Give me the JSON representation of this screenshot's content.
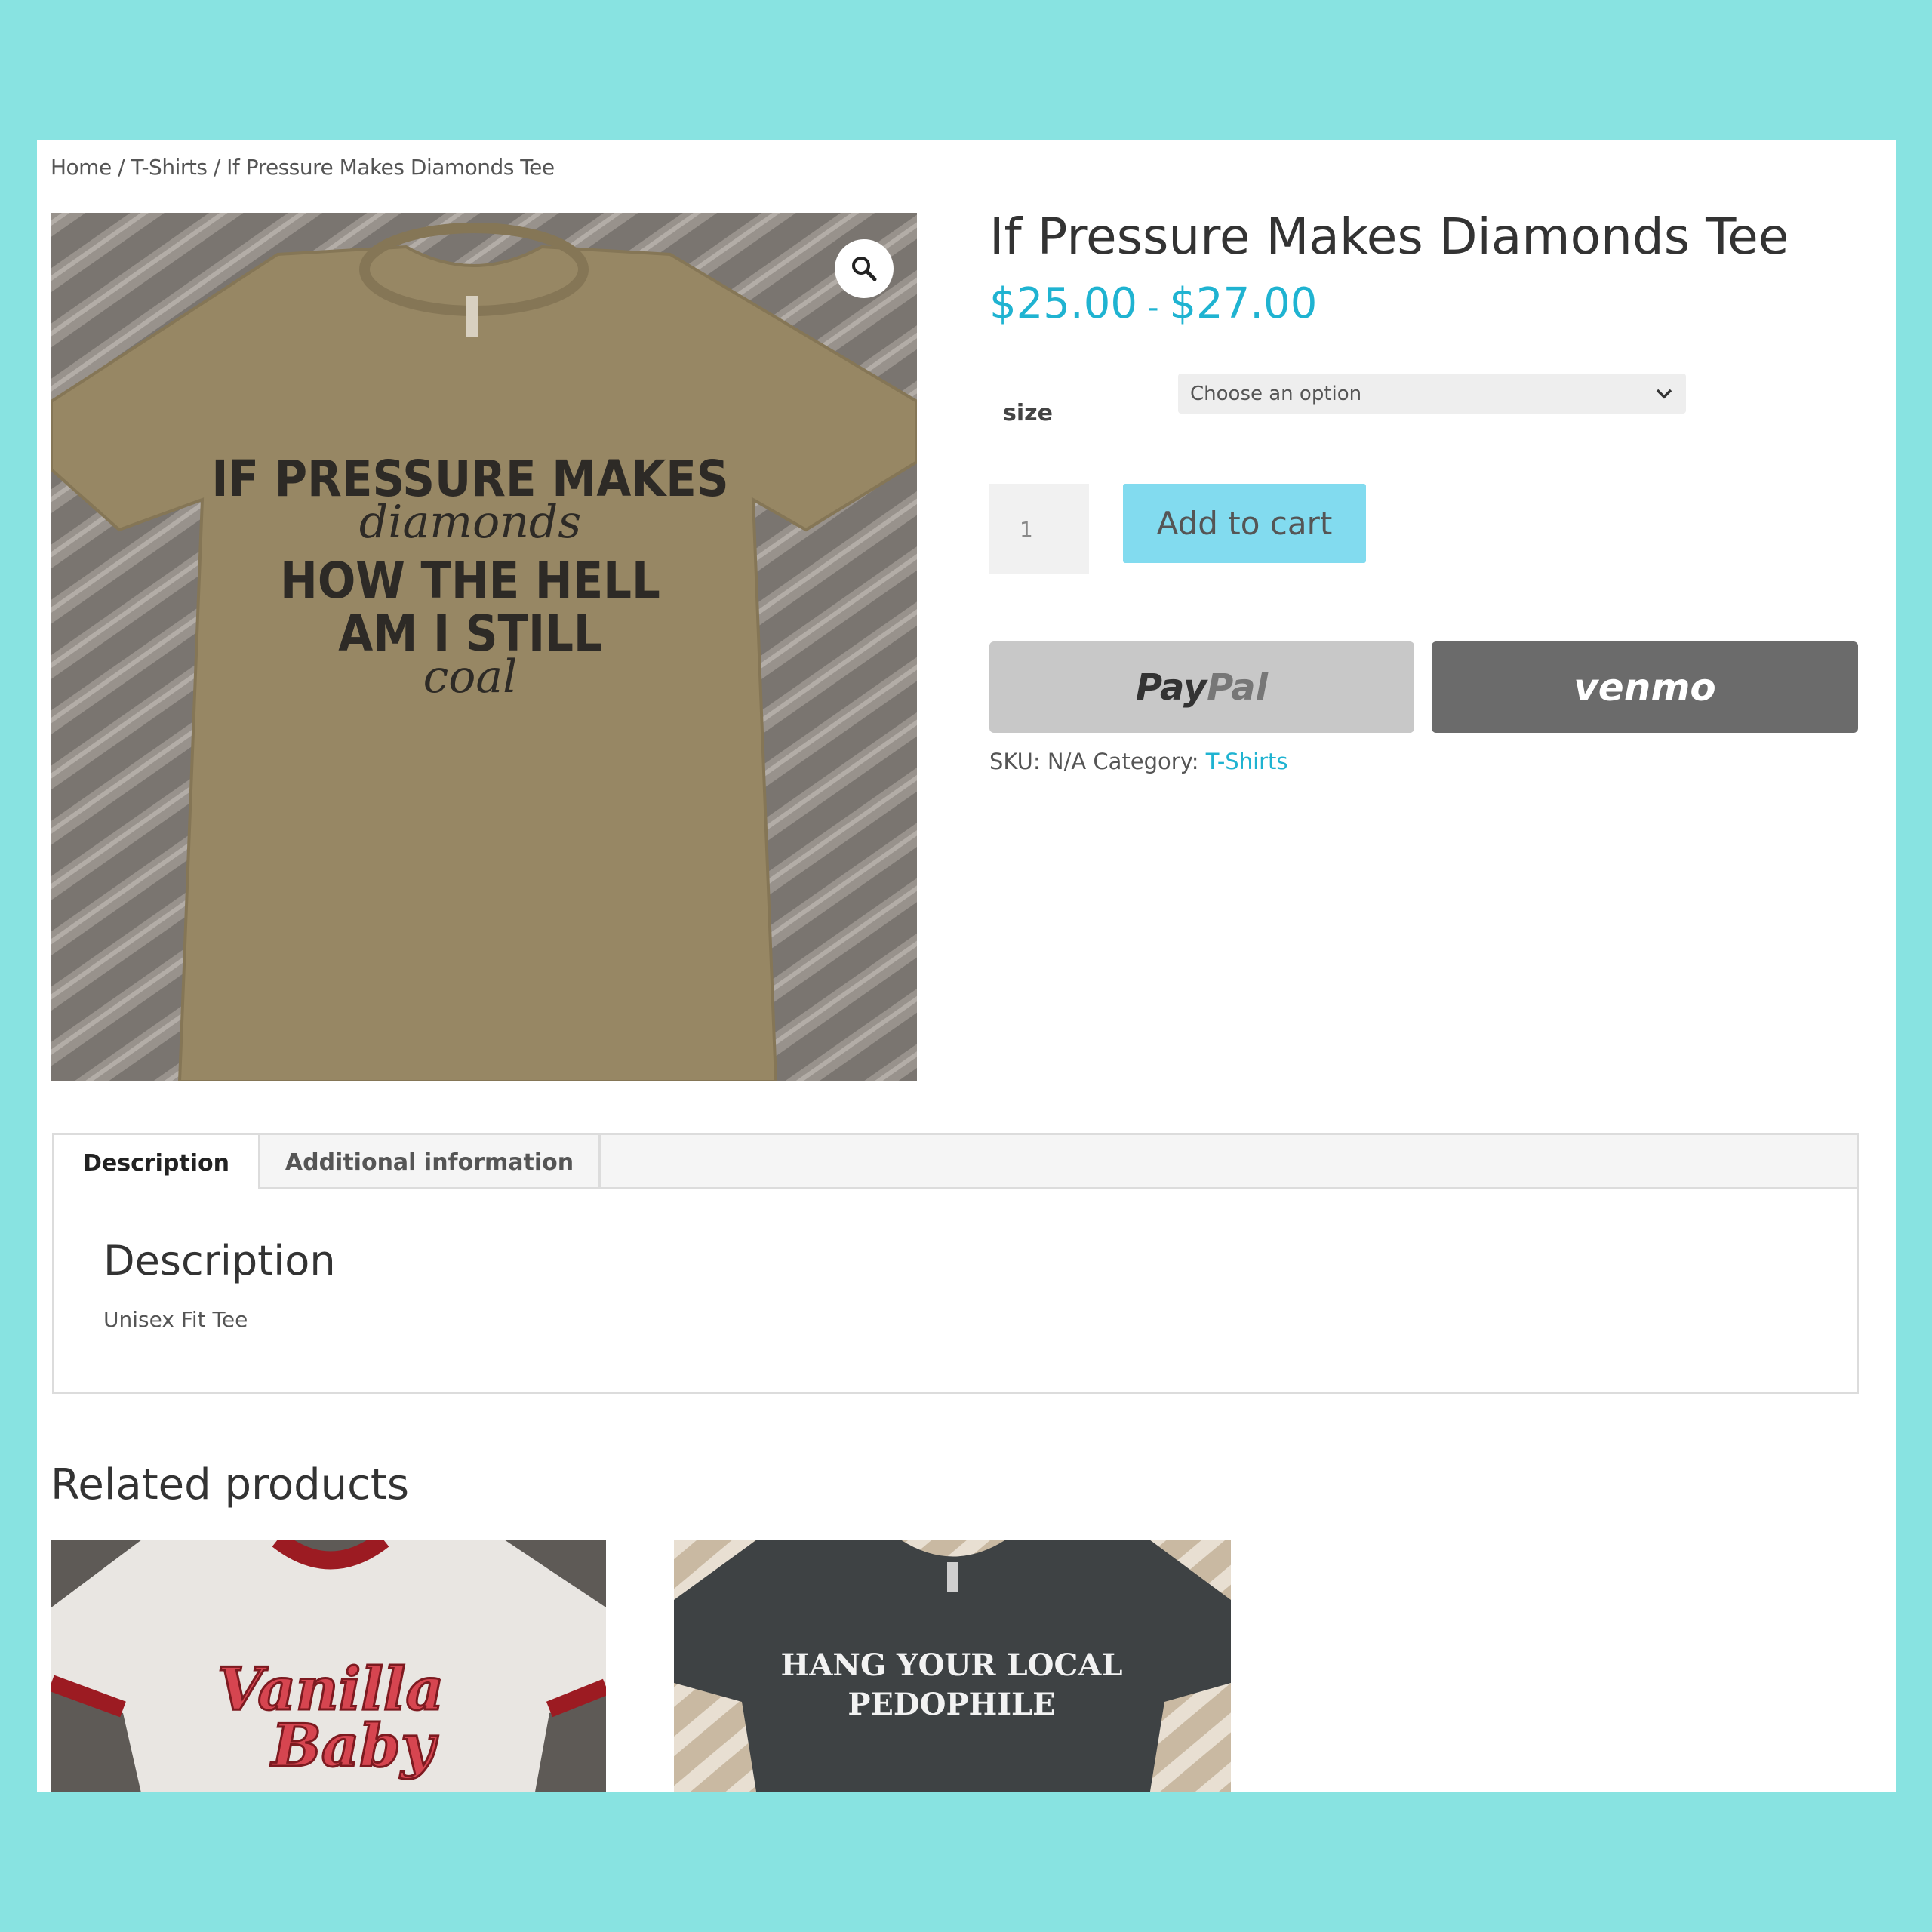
{
  "breadcrumb": {
    "home": "Home",
    "sep1": " / ",
    "category": "T-Shirts",
    "sep2": " / ",
    "current": "If Pressure Makes Diamonds Tee"
  },
  "product": {
    "title": "If Pressure Makes Diamonds Tee",
    "price_low": "$25.00",
    "price_sep": "-",
    "price_high": "$27.00",
    "image_text": {
      "line1": "IF PRESSURE MAKES",
      "line2": "diamonds",
      "line3": "HOW THE HELL",
      "line4": "AM I STILL",
      "line5": "coal"
    }
  },
  "variation": {
    "label": "size",
    "placeholder": "Choose an option"
  },
  "cart": {
    "quantity": "1",
    "add_label": "Add to cart"
  },
  "payment": {
    "paypal_pay": "Pay",
    "paypal_pal": "Pal",
    "venmo": "venmo"
  },
  "meta": {
    "sku_label": "SKU:",
    "sku_value": "N/A",
    "category_label": "Category:",
    "category_value": "T-Shirts"
  },
  "tabs": {
    "description": "Description",
    "additional": "Additional information"
  },
  "description": {
    "heading": "Description",
    "text": "Unisex Fit Tee"
  },
  "related": {
    "heading": "Related products",
    "items": [
      {
        "image_text_1": "Vanilla",
        "image_text_2": "Baby"
      },
      {
        "image_text_1": "HANG YOUR LOCAL",
        "image_text_2": "PEDOPHILE"
      }
    ]
  },
  "colors": {
    "background": "#88e3e1",
    "accent": "#1fb3d1",
    "add_to_cart": "#82dbef",
    "paypal": "#c8c8c8",
    "venmo": "#6b6b6b"
  }
}
